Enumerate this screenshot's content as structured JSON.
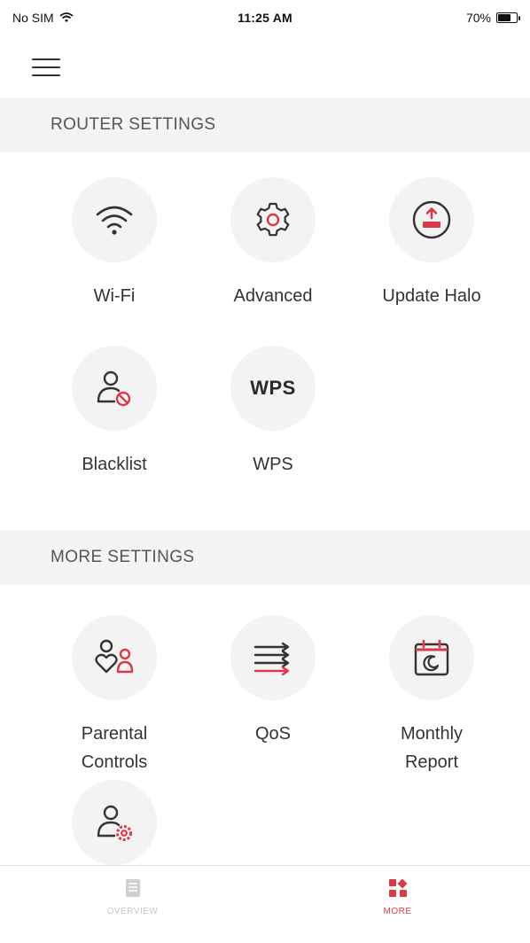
{
  "status_bar": {
    "carrier": "No SIM",
    "time": "11:25 AM",
    "battery_text": "70%",
    "battery_level": 0.7
  },
  "sections": {
    "router": {
      "title": "ROUTER SETTINGS",
      "items": [
        {
          "label": "Wi-Fi",
          "icon": "wifi-icon"
        },
        {
          "label": "Advanced",
          "icon": "gear-icon"
        },
        {
          "label": "Update Halo",
          "icon": "upload-icon"
        },
        {
          "label": "Blacklist",
          "icon": "user-blocked-icon"
        },
        {
          "label": "WPS",
          "icon_text": "WPS"
        }
      ]
    },
    "more": {
      "title": "MORE SETTINGS",
      "items": [
        {
          "label": "Parental\nControls",
          "icon": "parental-controls-icon"
        },
        {
          "label": "QoS",
          "icon": "qos-arrows-icon"
        },
        {
          "label": "Monthly\nReport",
          "icon": "calendar-report-icon"
        },
        {
          "label": "",
          "icon": "user-settings-icon"
        }
      ]
    }
  },
  "tab_bar": {
    "tabs": [
      {
        "label": "OVERVIEW",
        "icon": "overview-icon",
        "active": false
      },
      {
        "label": "MORE",
        "icon": "more-grid-icon",
        "active": true
      }
    ]
  },
  "colors": {
    "accent": "#d93a4a",
    "icon_dark": "#333333",
    "icon_bg": "#f3f3f3",
    "section_bg": "#f4f4f4"
  }
}
